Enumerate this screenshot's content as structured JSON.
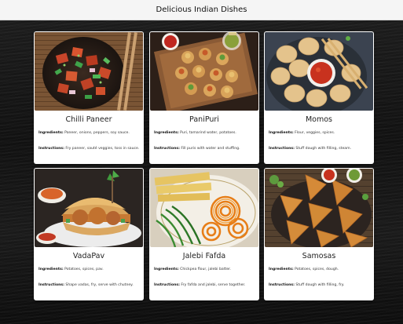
{
  "title": "Delicious Indian Dishes",
  "ingredients_label": "Ingredients:",
  "instructions_label": "Instructions:",
  "dishes": [
    {
      "name": "Chilli Paneer",
      "ingredients": "Paneer, onions, peppers, soy sauce.",
      "instructions": "Fry paneer, sauté veggies, toss in sauce."
    },
    {
      "name": "PaniPuri",
      "ingredients": "Puri, tamarind water, potatoes.",
      "instructions": "Fill puris with water and stuffing."
    },
    {
      "name": "Momos",
      "ingredients": "Flour, veggies, spices.",
      "instructions": "Stuff dough with filling, steam."
    },
    {
      "name": "VadaPav",
      "ingredients": "Potatoes, spices, pav.",
      "instructions": "Shape vadas, fry, serve with chutney."
    },
    {
      "name": "Jalebi Fafda",
      "ingredients": "Chickpea flour, jalebi batter.",
      "instructions": "Fry fafda and jalebi, serve together."
    },
    {
      "name": "Samosas",
      "ingredients": "Potatoes, spices, dough.",
      "instructions": "Stuff dough with filling, fry."
    }
  ]
}
